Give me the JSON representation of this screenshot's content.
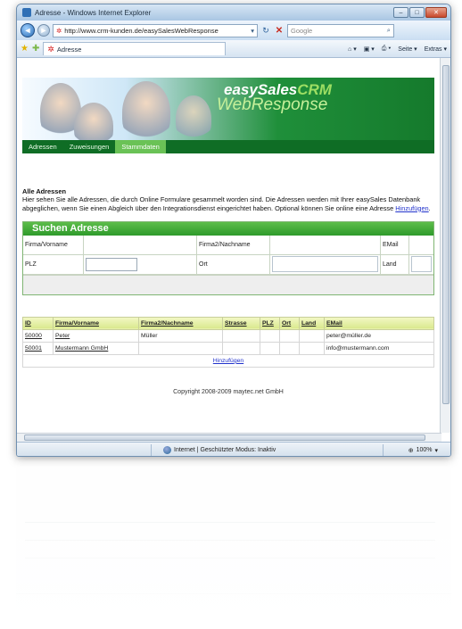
{
  "window": {
    "title": "Adresse - Windows Internet Explorer",
    "min": "–",
    "max": "□",
    "close": "✕"
  },
  "addressbar": {
    "url": "http://www.crm-kunden.de/easySalesWebResponse",
    "search_placeholder": "Google"
  },
  "tab": {
    "label": "Adresse"
  },
  "toolbar": {
    "home": "⌂ ▾",
    "feeds": "▣ ▾",
    "print": "⎙ ▾",
    "page": "Seite ▾",
    "tools": "Extras ▾"
  },
  "banner": {
    "logo_brand": "easySales",
    "logo_crm": "CRM",
    "logo_product": "WebResponse"
  },
  "menu": [
    {
      "label": "Adressen",
      "active": false
    },
    {
      "label": "Zuweisungen",
      "active": false
    },
    {
      "label": "Stammdaten",
      "active": true
    }
  ],
  "intro": {
    "heading": "Alle Adressen",
    "text": "Hier sehen Sie alle Adressen, die durch Online Formulare gesammelt worden sind. Die Adressen werden mit Ihrer easySales Datenbank abgeglichen, wenn Sie einen Abgleich über den Integrationsdienst eingerichtet haben. Optional können Sie online eine Adresse ",
    "link": "Hinzufügen",
    "end": "."
  },
  "search": {
    "title": "Suchen Adresse",
    "row1": {
      "l1": "Firma/Vorname",
      "l2": "Firma2/Nachname",
      "l3": "EMail"
    },
    "row2": {
      "l1": "PLZ",
      "l2": "Ort",
      "l3": "Land"
    }
  },
  "table": {
    "headers": [
      "ID",
      "Firma/Vorname",
      "Firma2/Nachname",
      "Strasse",
      "PLZ",
      "Ort",
      "Land",
      "EMail"
    ],
    "rows": [
      [
        "50000",
        "Peter",
        "Müller",
        "",
        "",
        "",
        "",
        "peter@müller.de"
      ],
      [
        "50001",
        "Mustermann GmbH",
        "",
        "",
        "",
        "",
        "",
        "info@mustermann.com"
      ]
    ],
    "add_link": "Hinzufügen"
  },
  "footer": {
    "copyright": "Copyright 2008-2009 maytec.net GmbH"
  },
  "statusbar": {
    "zone": "Internet | Geschützter Modus: Inaktiv",
    "zoom": "100%"
  }
}
